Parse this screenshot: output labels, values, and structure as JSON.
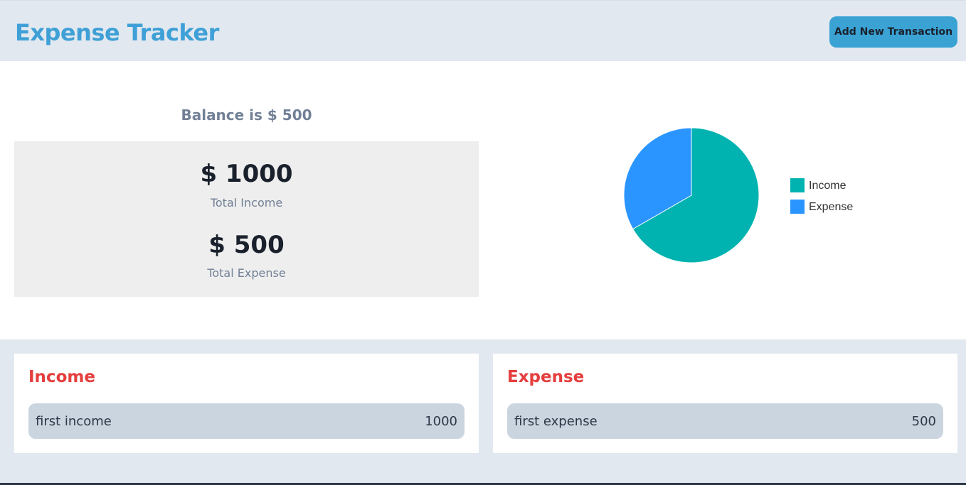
{
  "header": {
    "title": "Expense Tracker",
    "add_button_label": "Add New Transaction"
  },
  "summary": {
    "balance_text": "Balance is $ 500",
    "income_value": "$ 1000",
    "income_label": "Total Income",
    "expense_value": "$ 500",
    "expense_label": "Total Expense"
  },
  "chart_data": {
    "type": "pie",
    "categories": [
      "Income",
      "Expense"
    ],
    "values": [
      1000,
      500
    ],
    "colors": [
      "#00b3b0",
      "#2b95ff"
    ],
    "legend": "right"
  },
  "income_list": {
    "title": "Income",
    "items": [
      {
        "description": "first income",
        "amount": "1000"
      }
    ]
  },
  "expense_list": {
    "title": "Expense",
    "items": [
      {
        "description": "first expense",
        "amount": "500"
      }
    ]
  }
}
